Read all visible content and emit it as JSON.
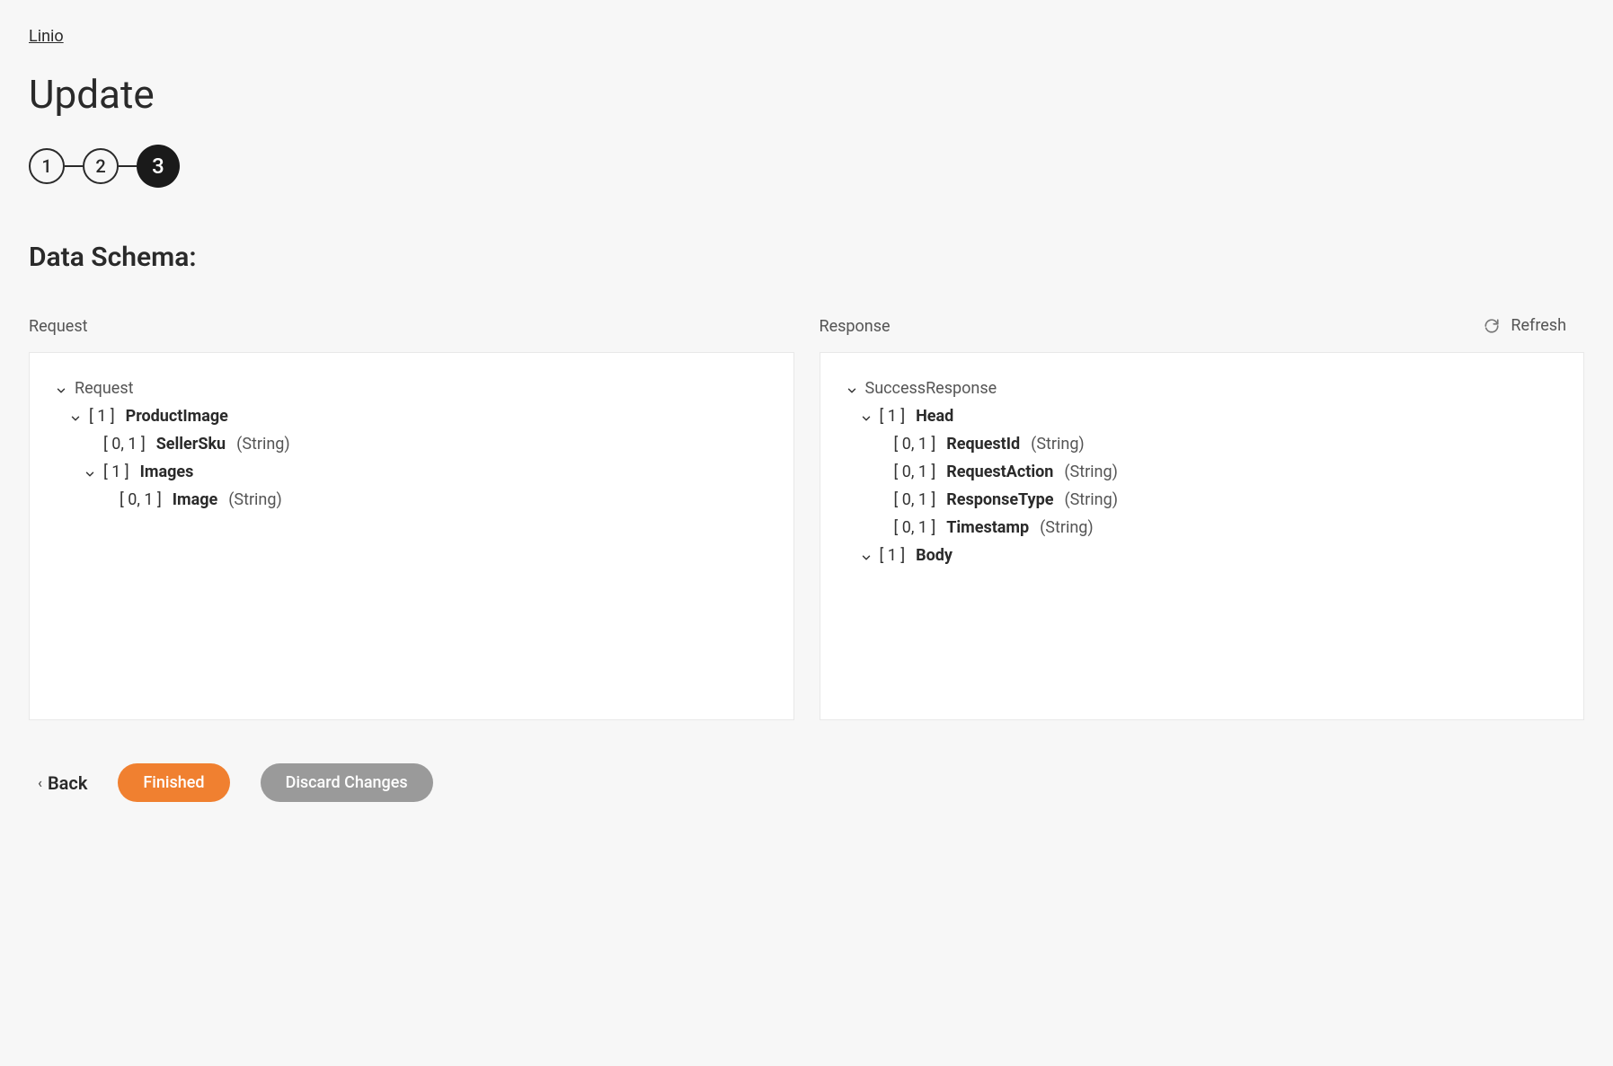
{
  "breadcrumb": "Linio",
  "page_title": "Update",
  "stepper": {
    "steps": [
      "1",
      "2",
      "3"
    ],
    "active_index": 2
  },
  "section_title": "Data Schema:",
  "refresh_label": "Refresh",
  "request": {
    "label": "Request",
    "root": "Request",
    "tree": {
      "product_image": {
        "cardinality": "[ 1 ]",
        "name": "ProductImage"
      },
      "seller_sku": {
        "cardinality": "[ 0, 1 ]",
        "name": "SellerSku",
        "type": "(String)"
      },
      "images": {
        "cardinality": "[ 1 ]",
        "name": "Images"
      },
      "image": {
        "cardinality": "[ 0, 1 ]",
        "name": "Image",
        "type": "(String)"
      }
    }
  },
  "response": {
    "label": "Response",
    "root": "SuccessResponse",
    "tree": {
      "head": {
        "cardinality": "[ 1 ]",
        "name": "Head"
      },
      "request_id": {
        "cardinality": "[ 0, 1 ]",
        "name": "RequestId",
        "type": "(String)"
      },
      "request_action": {
        "cardinality": "[ 0, 1 ]",
        "name": "RequestAction",
        "type": "(String)"
      },
      "response_type": {
        "cardinality": "[ 0, 1 ]",
        "name": "ResponseType",
        "type": "(String)"
      },
      "timestamp": {
        "cardinality": "[ 0, 1 ]",
        "name": "Timestamp",
        "type": "(String)"
      },
      "body": {
        "cardinality": "[ 1 ]",
        "name": "Body"
      }
    }
  },
  "actions": {
    "back": "Back",
    "finished": "Finished",
    "discard": "Discard Changes"
  }
}
